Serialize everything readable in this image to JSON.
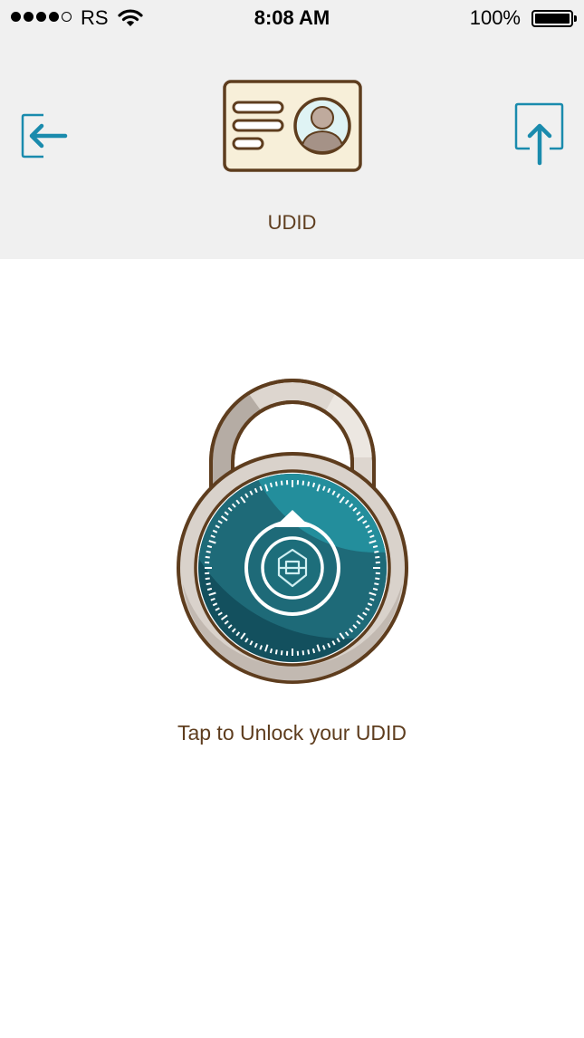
{
  "status_bar": {
    "signal_filled": 4,
    "signal_total": 5,
    "carrier": "RS",
    "time": "8:08 AM",
    "battery_percent": "100%",
    "wifi_icon": "wifi-icon",
    "battery_icon": "battery-icon"
  },
  "header": {
    "title": "UDID",
    "back_icon": "back-arrow-icon",
    "share_icon": "share-upload-icon",
    "card_icon": "id-card-icon"
  },
  "main": {
    "lock_icon": "combination-padlock-icon",
    "prompt": "Tap to Unlock your UDID"
  },
  "colors": {
    "accent_blue": "#1a8bad",
    "brown_text": "#5e3d1e",
    "header_bg": "#f0f0f0",
    "lock_teal": "#1d6e7b"
  }
}
